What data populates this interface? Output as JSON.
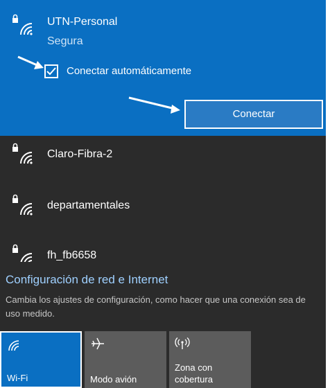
{
  "selected_network": {
    "name": "UTN-Personal",
    "status": "Segura",
    "auto_connect_label": "Conectar automáticamente",
    "auto_connect_checked": true,
    "connect_label": "Conectar"
  },
  "networks": [
    {
      "name": "Claro-Fibra-2",
      "secured": true
    },
    {
      "name": "departamentales",
      "secured": true
    },
    {
      "name": "fh_fb6658",
      "secured": true
    }
  ],
  "settings": {
    "link": "Configuración de red e Internet",
    "description": "Cambia los ajustes de configuración, como hacer que una conexión sea de uso medido."
  },
  "quick_actions": [
    {
      "label": "Wi-Fi",
      "icon": "wifi-icon",
      "active": true
    },
    {
      "label": "Modo avión",
      "icon": "airplane-icon",
      "active": false
    },
    {
      "label": "Zona con cobertura",
      "icon": "hotspot-icon",
      "active": false
    }
  ],
  "colors": {
    "accent": "#0a6fc2",
    "panel": "#2b2b2b",
    "link": "#9fd0ff",
    "tile_inactive": "#5c5c5c"
  }
}
